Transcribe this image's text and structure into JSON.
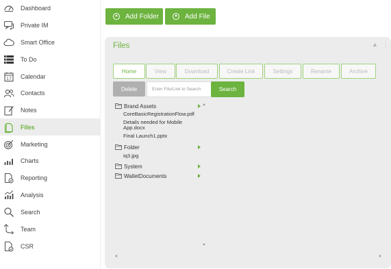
{
  "sidebar": {
    "items": [
      {
        "label": "Dashboard",
        "icon": "dashboard-icon"
      },
      {
        "label": "Private IM",
        "icon": "chat-icon"
      },
      {
        "label": "Smart Office",
        "icon": "cloud-icon"
      },
      {
        "label": "To Do",
        "icon": "list-icon"
      },
      {
        "label": "Calendar",
        "icon": "calendar-icon"
      },
      {
        "label": "Contacts",
        "icon": "contacts-icon"
      },
      {
        "label": "Notes",
        "icon": "notes-icon"
      },
      {
        "label": "Files",
        "icon": "files-icon",
        "active": true
      },
      {
        "label": "Marketing",
        "icon": "target-icon"
      },
      {
        "label": "Charts",
        "icon": "bar-chart-icon"
      },
      {
        "label": "Reporting",
        "icon": "report-icon"
      },
      {
        "label": "Analysis",
        "icon": "analysis-icon"
      },
      {
        "label": "Search",
        "icon": "search-icon"
      },
      {
        "label": "Team",
        "icon": "team-icon"
      },
      {
        "label": "CSR",
        "icon": "csr-icon"
      }
    ]
  },
  "actions": {
    "add_folder": "Add Folder",
    "add_file": "Add File"
  },
  "panel": {
    "title": "Files",
    "tabs": [
      {
        "label": "Home",
        "active": true
      },
      {
        "label": "View"
      },
      {
        "label": "Download"
      },
      {
        "label": "Create Link"
      },
      {
        "label": "Settings"
      },
      {
        "label": "Rename"
      },
      {
        "label": "Archive"
      }
    ],
    "delete_label": "Delete",
    "search_placeholder": "Enter File/Link to Search",
    "search_label": "Search"
  },
  "tree": {
    "items": [
      {
        "type": "folder",
        "name": "Brand Assets"
      },
      {
        "type": "file",
        "name": "CoreBasicRegistrationFlow.pdf"
      },
      {
        "type": "file",
        "name": "Details needed for Mobile App.docx"
      },
      {
        "type": "file",
        "name": "Final Launch1.pptx"
      },
      {
        "type": "folder",
        "name": "Folder"
      },
      {
        "type": "file",
        "name": "iq3.jpg"
      },
      {
        "type": "folder",
        "name": "System"
      },
      {
        "type": "folder",
        "name": "WalletDocuments"
      }
    ]
  },
  "colors": {
    "accent": "#6db33f",
    "panel_bg": "#ececec",
    "disabled_tab_text": "#bbbbbb",
    "delete_bg": "#b0b0b0"
  }
}
